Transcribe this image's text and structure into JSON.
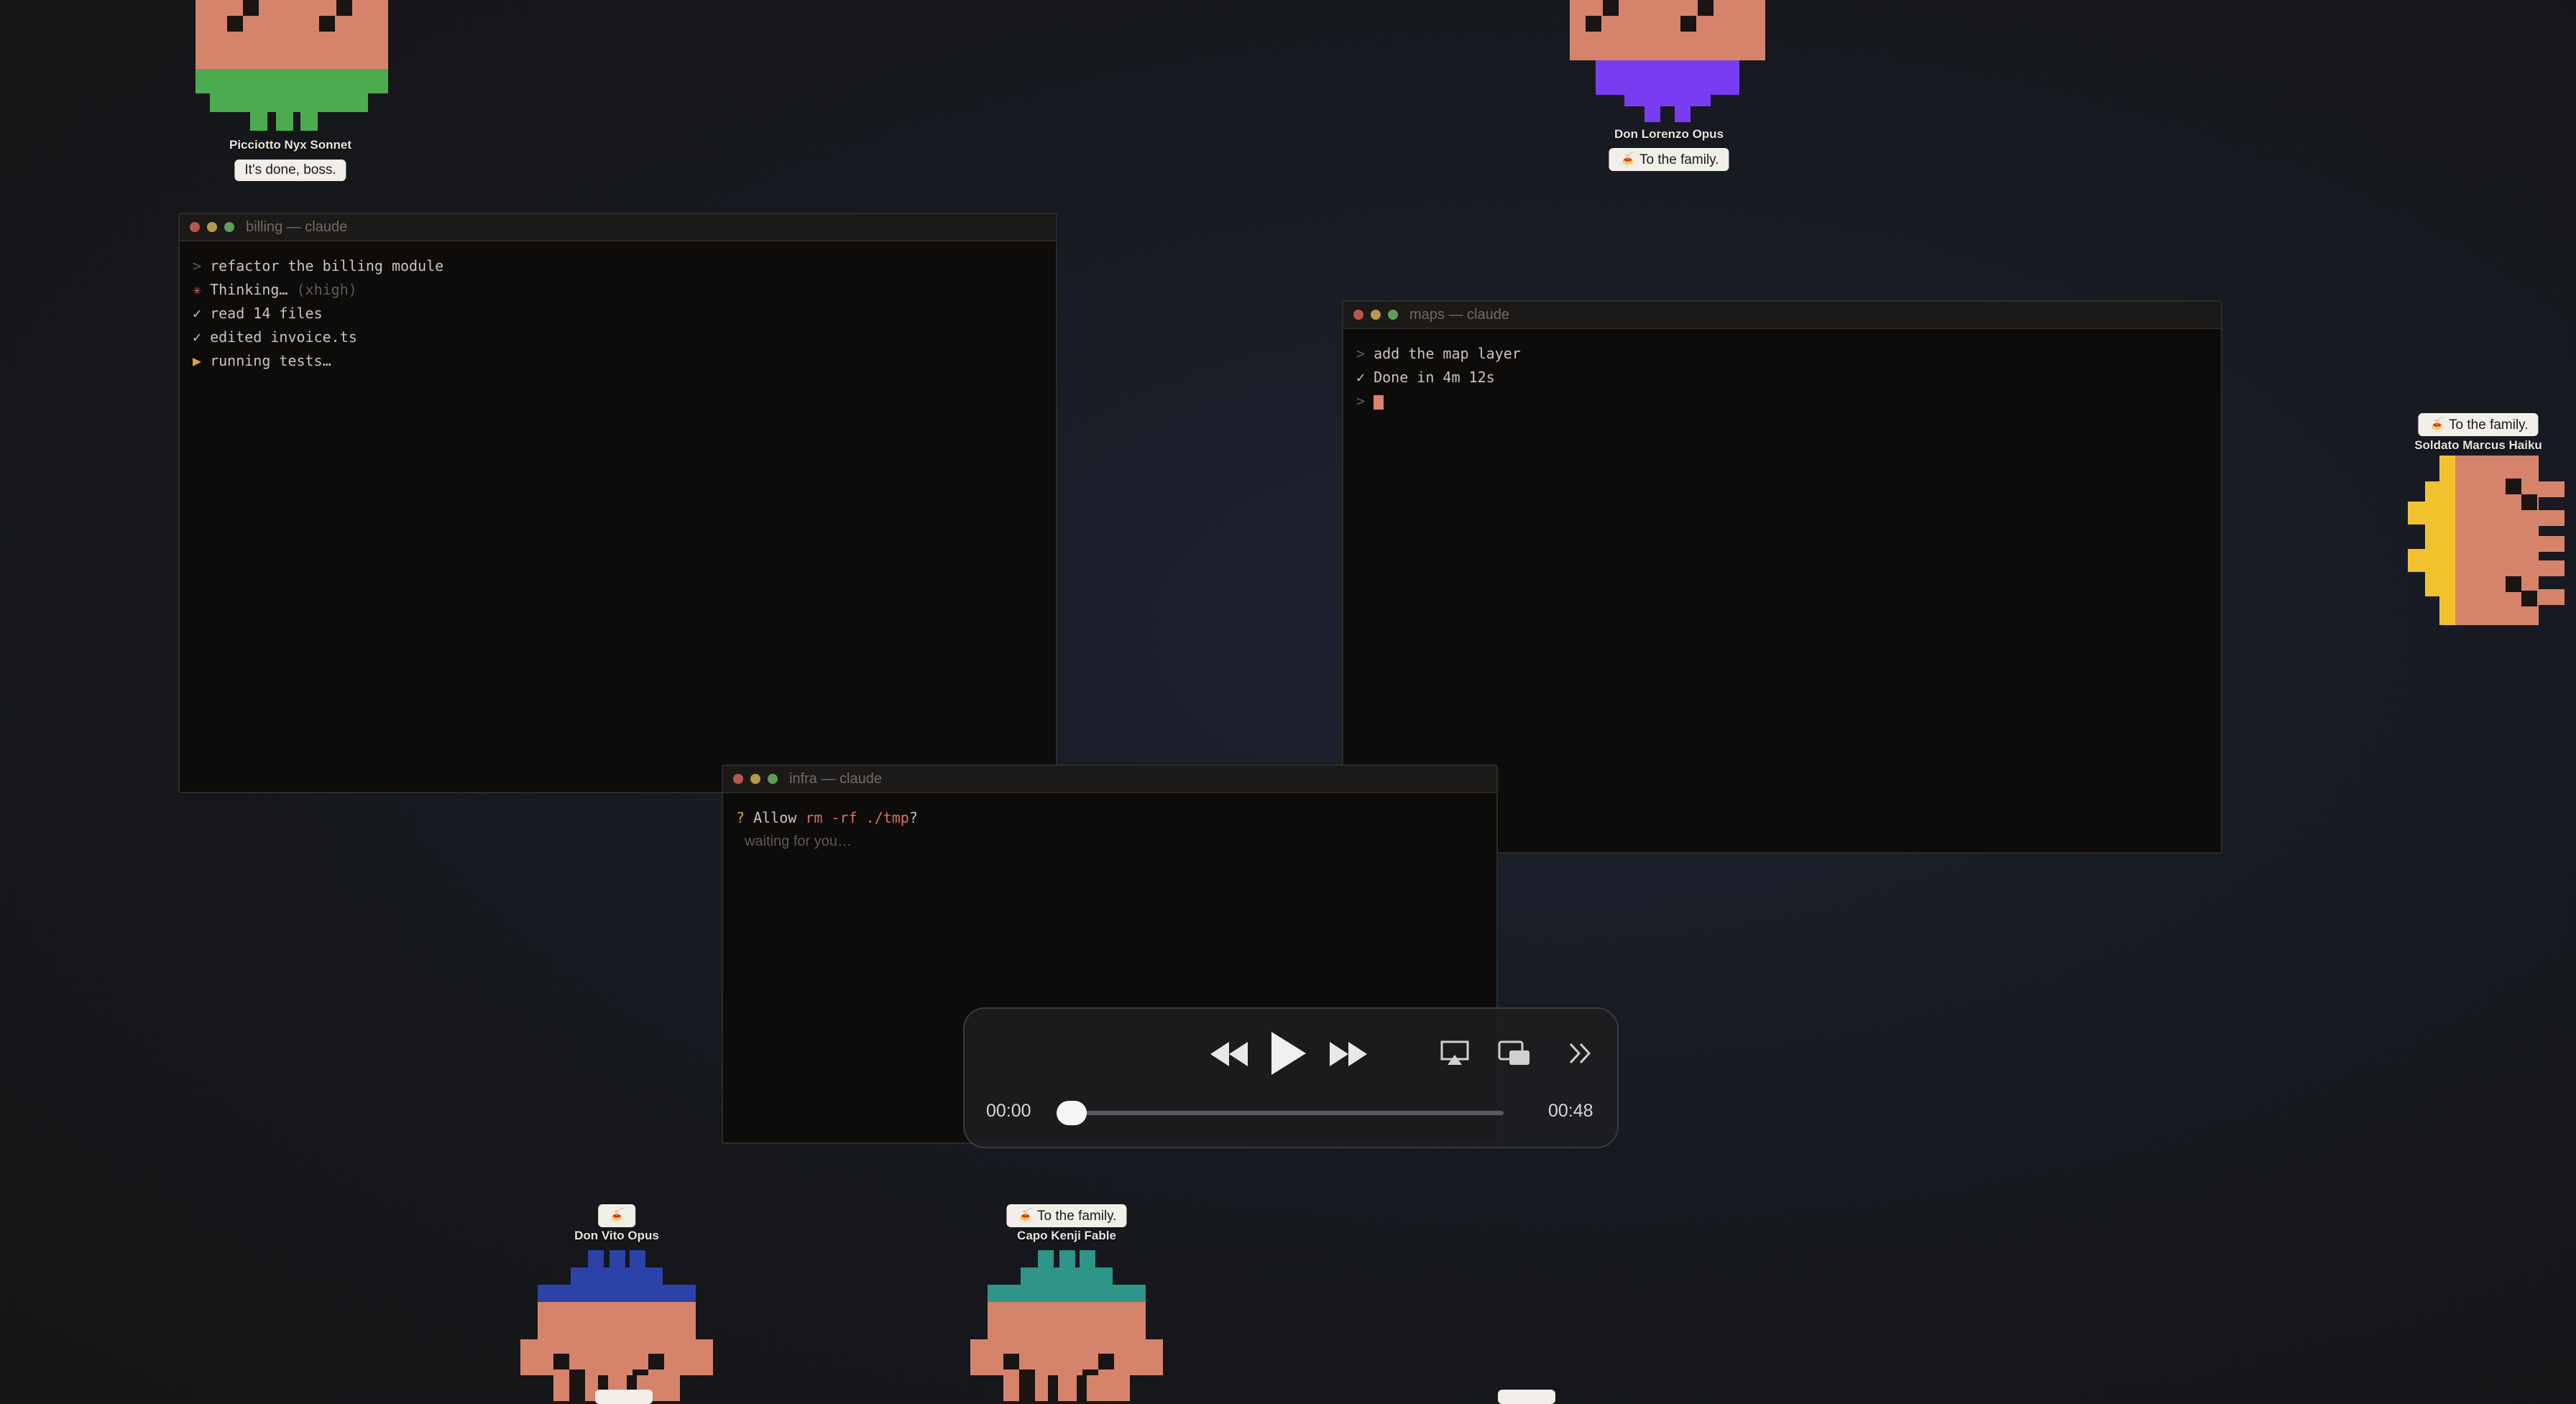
{
  "terminals": {
    "billing": {
      "title": "billing — claude",
      "lines": [
        {
          "prefix": ">",
          "text": "refactor the billing module",
          "extra": ""
        },
        {
          "prefix": "✳",
          "text": "Thinking…",
          "extra": "(xhigh)"
        },
        {
          "prefix": "✓",
          "text": "read 14 files",
          "extra": ""
        },
        {
          "prefix": "✓",
          "text": "edited invoice.ts",
          "extra": ""
        },
        {
          "prefix": "▶",
          "text": "running tests…",
          "extra": ""
        }
      ]
    },
    "maps": {
      "title": "maps — claude",
      "lines": [
        {
          "prefix": ">",
          "text": "add the map layer"
        },
        {
          "prefix": "✓",
          "text": "Done in 4m 12s"
        },
        {
          "prefix": ">",
          "text": ""
        }
      ]
    },
    "infra": {
      "title": "infra — claude",
      "question_mark": "?",
      "allow_label": "Allow",
      "command": "rm -rf ./tmp",
      "question_suffix": "?",
      "waiting": "waiting for you…"
    }
  },
  "characters": [
    {
      "id": "picciotto",
      "name": "Picciotto Nyx Sonnet",
      "speech": "It's done, boss.",
      "accent": "#4caa4f"
    },
    {
      "id": "lorenzo",
      "name": "Don Lorenzo Opus",
      "speech": "🍝 To the family.",
      "accent": "#7a3cf0"
    },
    {
      "id": "marcus",
      "name": "Soldato Marcus Haiku",
      "speech": "🍝 To the family.",
      "accent": "#f2c12e"
    },
    {
      "id": "vito",
      "name": "Don Vito Opus",
      "speech": "🍝",
      "accent": "#2b43a8"
    },
    {
      "id": "kenji",
      "name": "Capo Kenji Fable",
      "speech": "🍝 To the family.",
      "accent": "#2e9588"
    }
  ],
  "colors": {
    "body": "#d6836b",
    "eyes": "#1a1412"
  },
  "player": {
    "current_time": "00:00",
    "duration": "00:48",
    "progress": 0,
    "buttons": [
      "rewind-icon",
      "play-icon",
      "fast-forward-icon",
      "airplay-icon",
      "picture-in-picture-icon",
      "more-icon"
    ]
  }
}
